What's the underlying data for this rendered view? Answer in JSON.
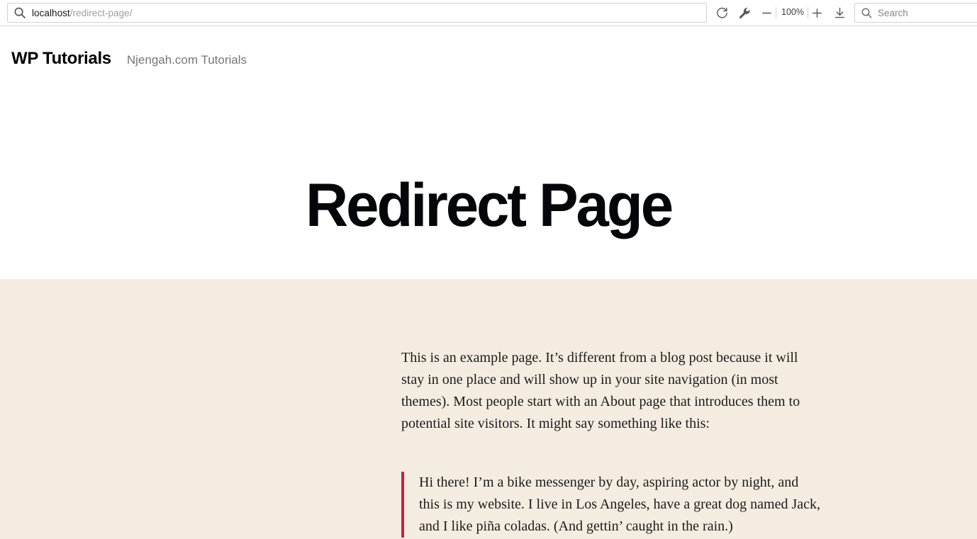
{
  "browser": {
    "url_host": "localhost",
    "url_path": "/redirect-page/",
    "reload_icon": "reload-icon",
    "wrench_icon": "wrench-icon",
    "zoom_out_icon": "minus-icon",
    "zoom_level": "100%",
    "zoom_in_icon": "plus-icon",
    "download_icon": "download-icon",
    "search_icon": "search-icon",
    "search_placeholder": "Search",
    "search_value": ""
  },
  "site": {
    "title": "WP Tutorials",
    "tagline": "Njengah.com Tutorials"
  },
  "page": {
    "title": "Redirect Page",
    "intro_paragraph": "This is an example page. It’s different from a blog post because it will stay in one place and will show up in your site navigation (in most themes). Most people start with an About page that introduces them to potential site visitors. It might say something like this:",
    "blockquote": "Hi there! I’m a bike messenger by day, aspiring actor by night, and this is my website. I live in Los Angeles, have a great dog named Jack, and I like piña coladas. (And gettin’ caught in the rain.)"
  },
  "colors": {
    "band_background": "#f4ece0",
    "blockquote_accent": "#ca1f4b",
    "page_background": "#ffffff",
    "tagline": "#767676"
  }
}
